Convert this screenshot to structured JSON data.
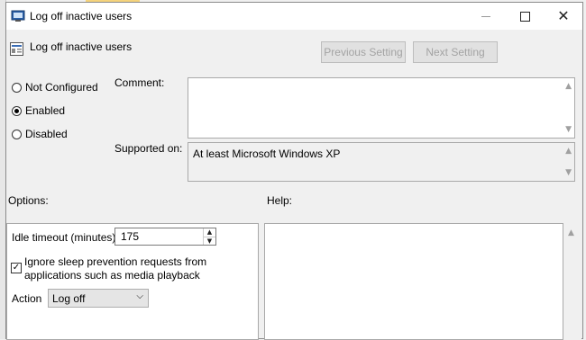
{
  "window": {
    "title": "Log off inactive users",
    "controls": {
      "minimize": "—",
      "maximize": "□",
      "close": "✕"
    }
  },
  "header": {
    "policy_name": "Log off inactive users",
    "previous_label": "Previous Setting",
    "next_label": "Next Setting"
  },
  "state": {
    "options": [
      {
        "label": "Not Configured",
        "selected": false
      },
      {
        "label": "Enabled",
        "selected": true
      },
      {
        "label": "Disabled",
        "selected": false
      }
    ]
  },
  "comment": {
    "label": "Comment:",
    "value": ""
  },
  "supported": {
    "label": "Supported on:",
    "value": "At least Microsoft Windows XP"
  },
  "options_section": {
    "label": "Options:",
    "idle_timeout_label": "Idle timeout (minutes)",
    "idle_timeout_value": "175",
    "ignore_sleep_line1": "Ignore sleep prevention requests from",
    "ignore_sleep_line2": "applications such as media playback",
    "ignore_sleep_checked": true,
    "action_label": "Action",
    "action_value": "Log off"
  },
  "help_section": {
    "label": "Help:"
  },
  "icons": {
    "title": "policy-icon",
    "header": "setting-icon",
    "scroll_up": "▲",
    "scroll_down": "▼",
    "check": "✓",
    "dropdown": "⌵"
  }
}
